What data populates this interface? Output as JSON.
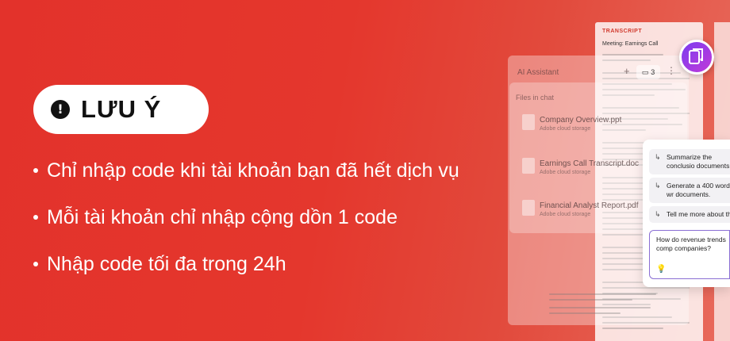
{
  "notice": {
    "title": "LƯU Ý",
    "icon": "exclamation-icon",
    "bullets": [
      "Chỉ nhập code khi tài khoản bạn đã hết dịch vụ",
      "Mỗi tài khoản chỉ nhập cộng dồn 1 code",
      "Nhập code tối đa trong 24h"
    ]
  },
  "mockup": {
    "transcript_heading": "TRANSCRIPT",
    "meeting_title": "Meeting: Earnings Call",
    "panel_title": "AI Assistant",
    "file_count": "3",
    "files_label": "Files in chat",
    "files": [
      {
        "name": "Company Overview.ppt",
        "source": "Adobe cloud storage"
      },
      {
        "name": "Earnings Call Transcript.doc",
        "source": "Adobe cloud storage"
      },
      {
        "name": "Financial Analyst Report.pdf",
        "source": "Adobe cloud storage"
      }
    ],
    "suggestions": [
      "Summarize the conclusio documents.",
      "Generate a 400 word wr documents.",
      "Tell me more about the"
    ],
    "prompt": "How do revenue trends comp companies?"
  },
  "colors": {
    "background": "#e3322b",
    "badge": "#7b3df0"
  }
}
